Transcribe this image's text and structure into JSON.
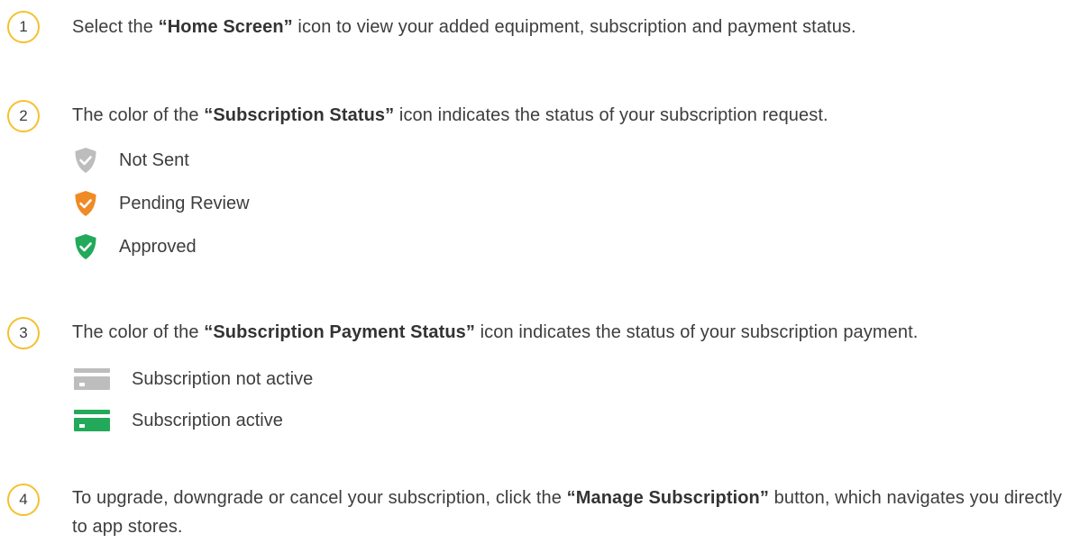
{
  "steps": [
    {
      "number": "1",
      "prefix": "Select the ",
      "bold": "“Home Screen”",
      "suffix": " icon to view your added equipment, subscription and payment status."
    },
    {
      "number": "2",
      "prefix": "The color of the ",
      "bold": "“Subscription Status”",
      "suffix": " icon indicates the status of your subscription request.",
      "items": [
        {
          "label": "Not Sent",
          "icon": "shield-check-icon",
          "color": "#bdbdbd"
        },
        {
          "label": "Pending Review",
          "icon": "shield-check-icon",
          "color": "#f08a24"
        },
        {
          "label": "Approved",
          "icon": "shield-check-icon",
          "color": "#22a95a"
        }
      ]
    },
    {
      "number": "3",
      "prefix": "The color of the ",
      "bold": "“Subscription Payment Status”",
      "suffix": " icon indicates the status of your subscription payment.",
      "items": [
        {
          "label": "Subscription not active",
          "icon": "credit-card-icon",
          "color": "#bdbdbd"
        },
        {
          "label": "Subscription active",
          "icon": "credit-card-icon",
          "color": "#22a95a"
        }
      ]
    },
    {
      "number": "4",
      "prefix": "To upgrade, downgrade or cancel your subscription, click the ",
      "bold": "“Manage Subscription”",
      "suffix": " button, which navigates you directly to app stores."
    }
  ],
  "colors": {
    "badge_border": "#f5c12e",
    "text": "#3d3d3d"
  }
}
